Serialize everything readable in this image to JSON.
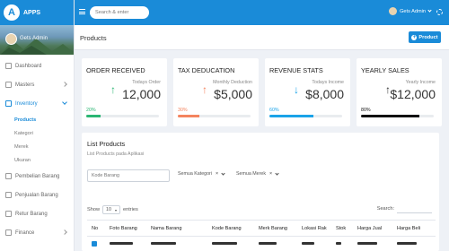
{
  "app": {
    "name": "APPS",
    "logo_letter": "A"
  },
  "topbar": {
    "search_placeholder": "Search & enter",
    "user": "Gets Admin"
  },
  "profile": {
    "name": "Gets Admin"
  },
  "sidebar": {
    "items": [
      {
        "label": "Dashboard",
        "icon": "home-icon"
      },
      {
        "label": "Masters",
        "icon": "grid-icon",
        "expandable": true
      },
      {
        "label": "Inventory",
        "icon": "settings-icon",
        "expandable": true,
        "active": true
      }
    ],
    "inventory_sub": [
      "Products",
      "Kategori",
      "Merek",
      "Ukuran"
    ],
    "more": [
      {
        "label": "Pembelian Barang",
        "icon": "cart-icon"
      },
      {
        "label": "Penjualan Barang",
        "icon": "document-icon"
      },
      {
        "label": "Retur Barang",
        "icon": "return-icon"
      },
      {
        "label": "Finance",
        "icon": "finance-icon",
        "expandable": true
      }
    ]
  },
  "page": {
    "title": "Products",
    "add_button": "Product"
  },
  "stats": [
    {
      "title": "ORDER RECEIVED",
      "caption": "Todays Order",
      "value": "12,000",
      "percent_label": "20%",
      "percent": 20,
      "color": "#2bb673",
      "arrow": "up"
    },
    {
      "title": "TAX DEDUCATION",
      "caption": "Monthly Deduction",
      "value": "$5,000",
      "percent_label": "30%",
      "percent": 30,
      "color": "#f4845f",
      "arrow": "up"
    },
    {
      "title": "REVENUE STATS",
      "caption": "Todays Income",
      "value": "$8,000",
      "percent_label": "60%",
      "percent": 60,
      "color": "#1aa3e8",
      "arrow": "down"
    },
    {
      "title": "YEARLY SALES",
      "caption": "Yearly Income",
      "value": "$12,000",
      "percent_label": "80%",
      "percent": 80,
      "color": "#111111",
      "arrow": "up"
    }
  ],
  "list": {
    "title": "List Products",
    "subtitle": "List Products pada Aplikasi",
    "filter_placeholder": "Kode Barang",
    "kategori": "Semua Kategori",
    "merek": "Semua Merek",
    "clear_symbol": "×",
    "show_label": "Show",
    "show_value": "10",
    "entries_label": "entries",
    "search_label": "Search:",
    "columns": [
      "No",
      "Foto Barang",
      "Nama Barang",
      "Kode Barang",
      "Merk Barang",
      "Lokasi Rak",
      "Stok",
      "Harga Jual",
      "Harga Beli"
    ]
  }
}
